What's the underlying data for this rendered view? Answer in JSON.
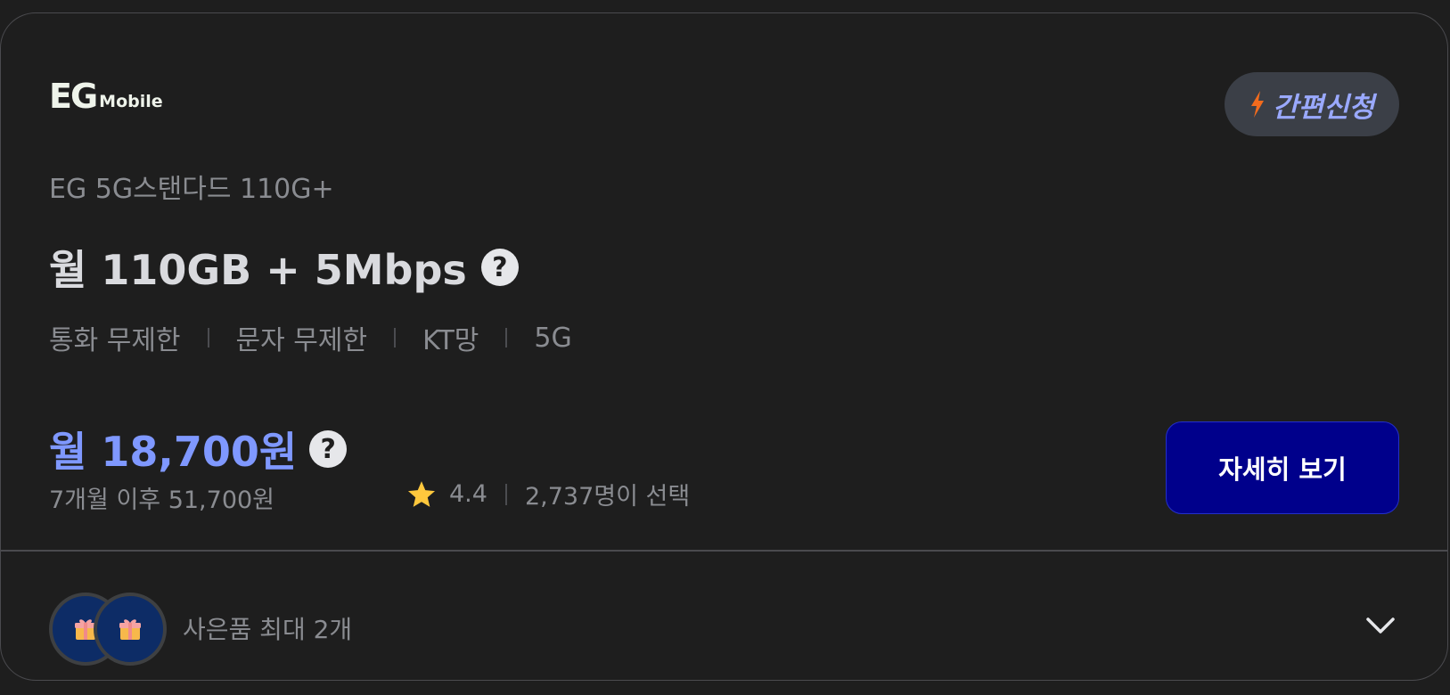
{
  "brand": {
    "logo_letters": "EG",
    "logo_word": "Mobile"
  },
  "quick_apply": {
    "label": "간편신청",
    "icon": "lightning-icon",
    "icon_color": "#f26b1d",
    "label_color": "#9aa9ff"
  },
  "plan": {
    "name": "EG 5G스탠다드 110G+",
    "headline": "월 110GB + 5Mbps",
    "features": [
      "통화 무제한",
      "문자 무제한",
      "KT망",
      "5G"
    ]
  },
  "pricing": {
    "price": "월 18,700원",
    "after_promo": "7개월 이후 51,700원",
    "price_color": "#7f98ff"
  },
  "rating": {
    "score": "4.4",
    "selected_count": "2,737명이 선택",
    "icon": "star-icon"
  },
  "detail_button": {
    "label": "자세히 보기",
    "bg_color": "#00008b"
  },
  "gifts": {
    "label": "사은품 최대 2개",
    "icon": "gift-icon",
    "expand_icon": "chevron-down-icon"
  }
}
